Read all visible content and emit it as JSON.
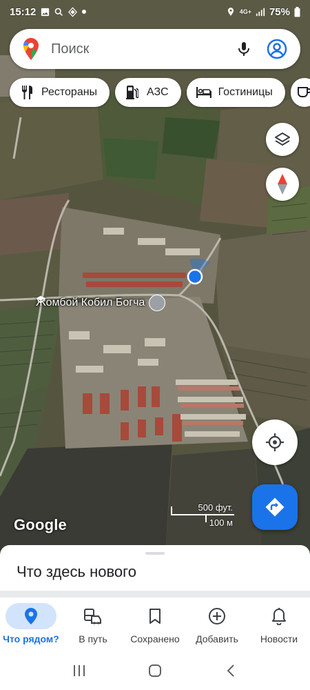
{
  "status_bar": {
    "time": "15:12",
    "network": "4G+",
    "battery": "75%",
    "icons": [
      "image-icon",
      "search-icon",
      "data-saver-icon",
      "dot-icon",
      "location-icon",
      "signal-icon",
      "battery-icon"
    ]
  },
  "search": {
    "placeholder": "Поиск",
    "icons": [
      "maps-pin-logo",
      "mic-icon",
      "account-icon"
    ]
  },
  "chips": [
    {
      "label": "Рестораны",
      "icon": "restaurant-icon"
    },
    {
      "label": "АЗС",
      "icon": "gas-station-icon"
    },
    {
      "label": "Гостиницы",
      "icon": "hotel-icon"
    },
    {
      "label": "",
      "icon": "coffee-icon"
    }
  ],
  "map": {
    "place_label": "Жомбой Кобил Богча",
    "place_icon": "school-icon",
    "scale_top": "500 фут.",
    "scale_bottom": "100 м",
    "logo": "Google",
    "buttons": [
      "layers-icon",
      "compass-icon",
      "my-location-icon",
      "directions-icon"
    ]
  },
  "sheet": {
    "title": "Что здесь нового"
  },
  "bottom_nav": [
    {
      "label": "Что рядом?",
      "icon": "explore-pin-icon",
      "active": true
    },
    {
      "label": "В путь",
      "icon": "commute-icon",
      "active": false
    },
    {
      "label": "Сохранено",
      "icon": "bookmark-icon",
      "active": false
    },
    {
      "label": "Добавить",
      "icon": "add-circle-icon",
      "active": false
    },
    {
      "label": "Новости",
      "icon": "bell-icon",
      "active": false
    }
  ],
  "system_nav": [
    "recents-icon",
    "home-icon",
    "back-icon"
  ],
  "colors": {
    "accent": "#1a73e8",
    "active_pill": "#d2e3fc",
    "location_dot": "#1a73e8"
  }
}
